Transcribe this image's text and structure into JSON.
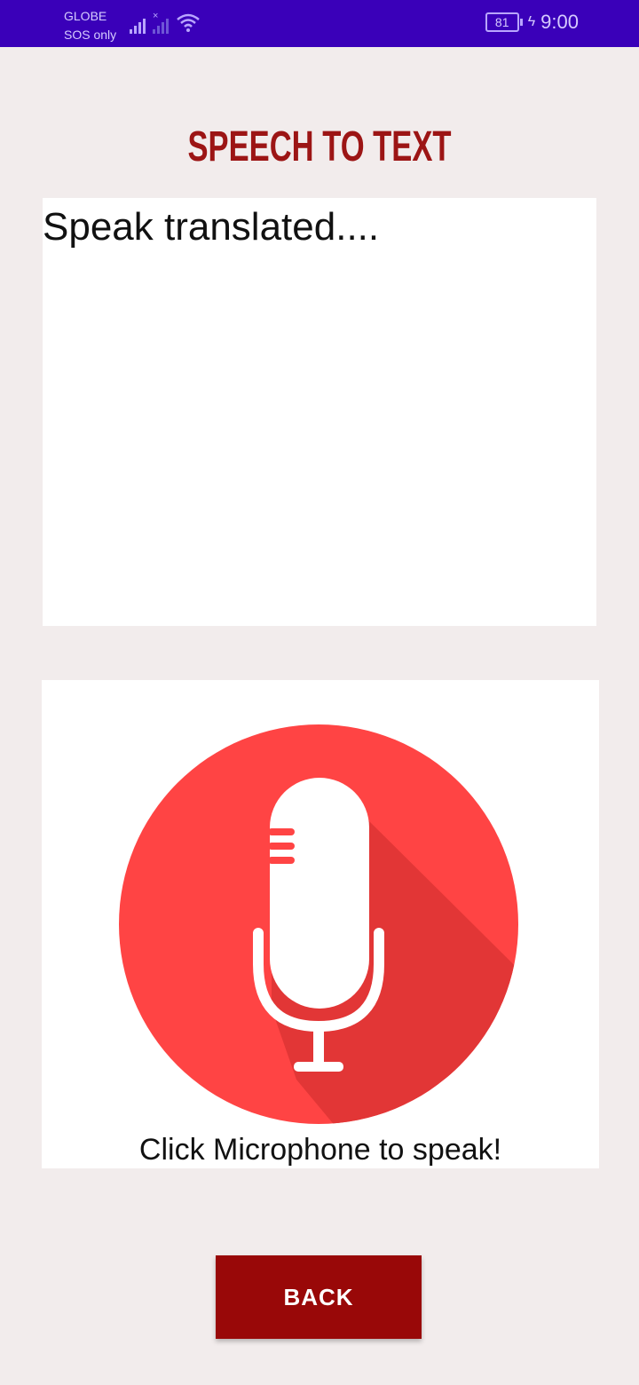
{
  "status_bar": {
    "carrier_line1": "GLOBE",
    "carrier_line2": "SOS only",
    "battery_level": "81",
    "time": "9:00",
    "icons": [
      "signal-icon",
      "signal-off-icon",
      "wifi-icon",
      "battery-icon",
      "charging-icon"
    ],
    "background_color": "#3a00b9"
  },
  "header": {
    "title": "SPEECH TO TEXT",
    "title_color": "#9c1515"
  },
  "output": {
    "text": "Speak translated...."
  },
  "mic": {
    "icon": "microphone-icon",
    "caption": "Click Microphone to speak!",
    "circle_color": "#ff4444"
  },
  "actions": {
    "back_label": "BACK",
    "back_color": "#990808"
  }
}
